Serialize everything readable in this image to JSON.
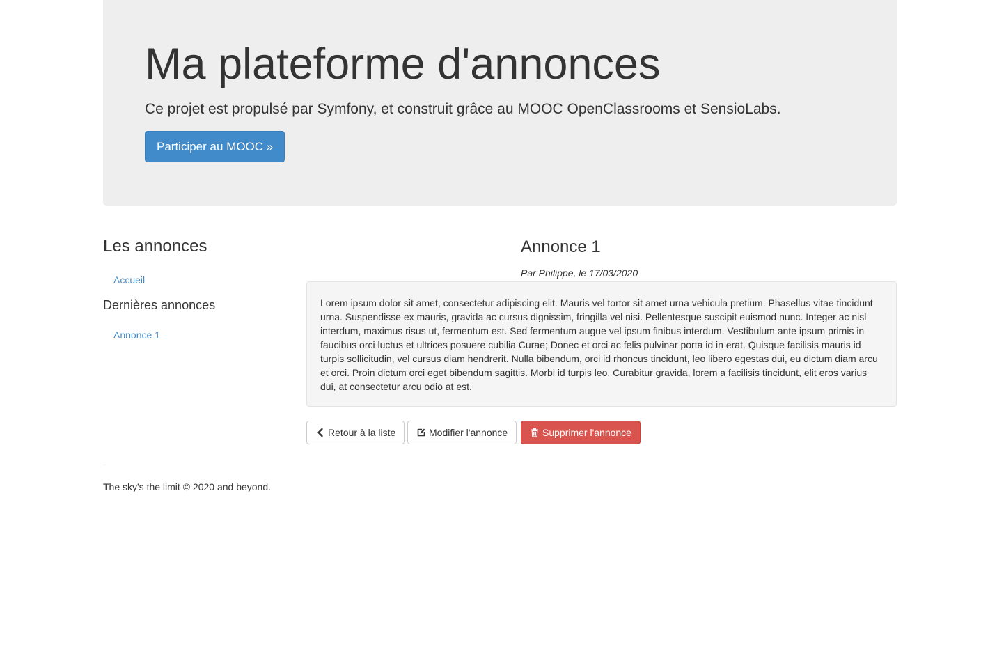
{
  "jumbotron": {
    "title": "Ma plateforme d'annonces",
    "lead": "Ce projet est propulsé par Symfony, et construit grâce au MOOC OpenClassrooms et SensioLabs.",
    "button_label": "Participer au MOOC »"
  },
  "sidebar": {
    "title": "Les annonces",
    "home_link": "Accueil",
    "latest_title": "Dernières annonces",
    "latest_items": [
      "Annonce 1"
    ]
  },
  "advert": {
    "title": "Annonce 1",
    "meta": "Par Philippe, le 17/03/2020",
    "content": "Lorem ipsum dolor sit amet, consectetur adipiscing elit. Mauris vel tortor sit amet urna vehicula pretium. Phasellus vitae tincidunt urna. Suspendisse ex mauris, gravida ac cursus dignissim, fringilla vel nisi. Pellentesque suscipit euismod nunc. Integer ac nisl interdum, maximus risus ut, fermentum est. Sed fermentum augue vel ipsum finibus interdum. Vestibulum ante ipsum primis in faucibus orci luctus et ultrices posuere cubilia Curae; Donec et orci ac felis pulvinar porta id in erat. Quisque facilisis mauris id turpis sollicitudin, vel cursus diam hendrerit. Nulla bibendum, orci id rhoncus tincidunt, leo libero egestas dui, eu dictum diam arcu et orci. Proin dictum orci eget bibendum sagittis. Morbi id turpis leo. Curabitur gravida, lorem a facilisis tincidunt, elit eros varius dui, at consectetur arcu odio at est."
  },
  "actions": {
    "back_label": "Retour à la liste",
    "back_icon": "chevron-left-icon",
    "edit_label": "Modifier l'annonce",
    "edit_icon": "edit-icon",
    "delete_label": "Supprimer l'annonce",
    "delete_icon": "trash-icon"
  },
  "footer": {
    "text": "The sky's the limit © 2020 and beyond."
  },
  "colors": {
    "primary": "#428bca",
    "danger": "#d9534f",
    "jumbotron_bg": "#eeeeee",
    "link": "#428bca"
  }
}
